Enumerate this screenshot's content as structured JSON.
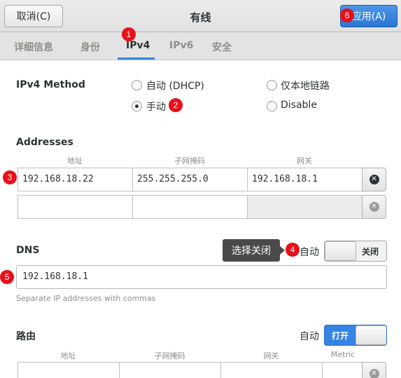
{
  "header": {
    "cancel_label": "取消(C)",
    "title": "有线",
    "apply_label": "应用(A)"
  },
  "tabs": [
    {
      "label": "详细信息"
    },
    {
      "label": "身份"
    },
    {
      "label": "IPv4"
    },
    {
      "label": "IPv6"
    },
    {
      "label": "安全"
    }
  ],
  "method": {
    "label": "IPv4 Method",
    "options": [
      {
        "label": "自动 (DHCP)",
        "checked": false
      },
      {
        "label": "仅本地链路",
        "checked": false
      },
      {
        "label": "手动",
        "checked": true
      },
      {
        "label": "Disable",
        "checked": false
      }
    ]
  },
  "addresses": {
    "label": "Addresses",
    "columns": [
      "地址",
      "子网掩码",
      "网关"
    ],
    "rows": [
      [
        "192.168.18.22",
        "255.255.255.0",
        "192.168.18.1"
      ],
      [
        "",
        "",
        ""
      ]
    ]
  },
  "dns": {
    "label": "DNS",
    "auto_label": "自动",
    "toggle_label": "关闭",
    "toggle_on": false,
    "value": "192.168.18.1",
    "hint": "Separate IP addresses with commas",
    "tooltip": "选择关闭"
  },
  "routes": {
    "label": "路由",
    "auto_label": "自动",
    "toggle_label": "打开",
    "toggle_on": true,
    "columns": [
      "地址",
      "子网掩码",
      "网关",
      "Metric"
    ]
  },
  "badges": [
    "1",
    "2",
    "3",
    "4",
    "5",
    "6"
  ],
  "colors": {
    "accent": "#3584e4",
    "badge": "#e8101a"
  }
}
